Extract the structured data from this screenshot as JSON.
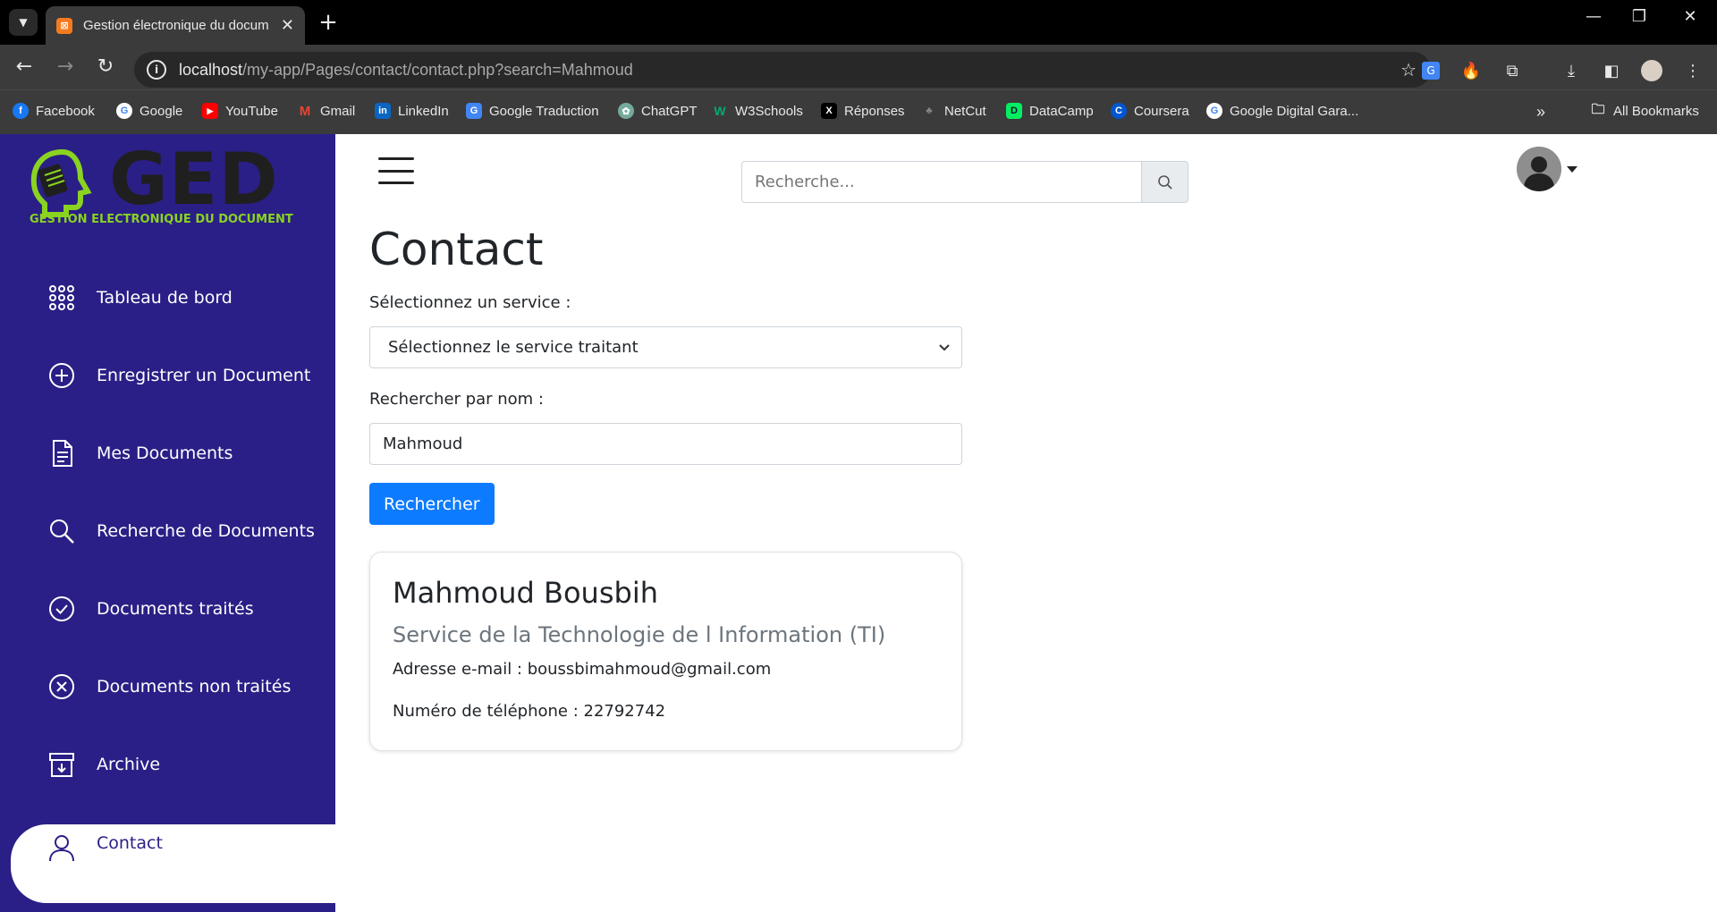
{
  "browser": {
    "tab_title": "Gestion électronique du docum",
    "url_host": "localhost",
    "url_path": "/my-app/Pages/contact/contact.php?search=Mahmoud",
    "bookmarks": [
      {
        "label": "Facebook",
        "icon": "facebook-icon",
        "color": "#1877f2"
      },
      {
        "label": "Google",
        "icon": "google-icon",
        "color": "#ffffff"
      },
      {
        "label": "YouTube",
        "icon": "youtube-icon",
        "color": "#ff0000"
      },
      {
        "label": "Gmail",
        "icon": "gmail-icon",
        "color": "#ea4335"
      },
      {
        "label": "LinkedIn",
        "icon": "linkedin-icon",
        "color": "#0a66c2"
      },
      {
        "label": "Google Traduction",
        "icon": "translate-icon",
        "color": "#4285f4"
      },
      {
        "label": "ChatGPT",
        "icon": "chatgpt-icon",
        "color": "#74aa9c"
      },
      {
        "label": "W3Schools",
        "icon": "w3schools-icon",
        "color": "#04aa6d"
      },
      {
        "label": "Réponses",
        "icon": "x-icon",
        "color": "#000000"
      },
      {
        "label": "NetCut",
        "icon": "netcut-icon",
        "color": "#666666"
      },
      {
        "label": "DataCamp",
        "icon": "datacamp-icon",
        "color": "#03ef62"
      },
      {
        "label": "Coursera",
        "icon": "coursera-icon",
        "color": "#0056d2"
      },
      {
        "label": "Google Digital Gara...",
        "icon": "google-icon",
        "color": "#ffffff"
      }
    ],
    "all_bookmarks": "All Bookmarks"
  },
  "sidebar": {
    "logo_text": "GED",
    "logo_subtitle": "GESTION ELECTRONIQUE DU DOCUMENT",
    "items": [
      {
        "label": "Tableau de bord",
        "icon": "dashboard-grid-icon"
      },
      {
        "label": "Enregistrer un Document",
        "icon": "plus-circle-icon"
      },
      {
        "label": "Mes Documents",
        "icon": "document-icon"
      },
      {
        "label": "Recherche de Documents",
        "icon": "search-icon"
      },
      {
        "label": "Documents traités",
        "icon": "check-circle-icon"
      },
      {
        "label": "Documents non traités",
        "icon": "x-circle-icon"
      },
      {
        "label": "Archive",
        "icon": "archive-icon"
      },
      {
        "label": "Contact",
        "icon": "user-icon",
        "active": true
      }
    ],
    "colors": {
      "background": "#2a1f86",
      "logo_accent": "#8ad321"
    }
  },
  "topbar": {
    "search_placeholder": "Recherche..."
  },
  "main": {
    "title": "Contact",
    "service_label": "Sélectionnez un service :",
    "service_selected": "Sélectionnez le service traitant",
    "name_label": "Rechercher par nom :",
    "name_value": "Mahmoud",
    "search_button": "Rechercher",
    "result": {
      "name": "Mahmoud Bousbih",
      "service": "Service de la Technologie de l Information (TI)",
      "email_line": "Adresse e-mail : boussbimahmoud@gmail.com",
      "phone_line": "Numéro de téléphone : 22792742"
    },
    "colors": {
      "primary": "#0d7bff"
    }
  }
}
